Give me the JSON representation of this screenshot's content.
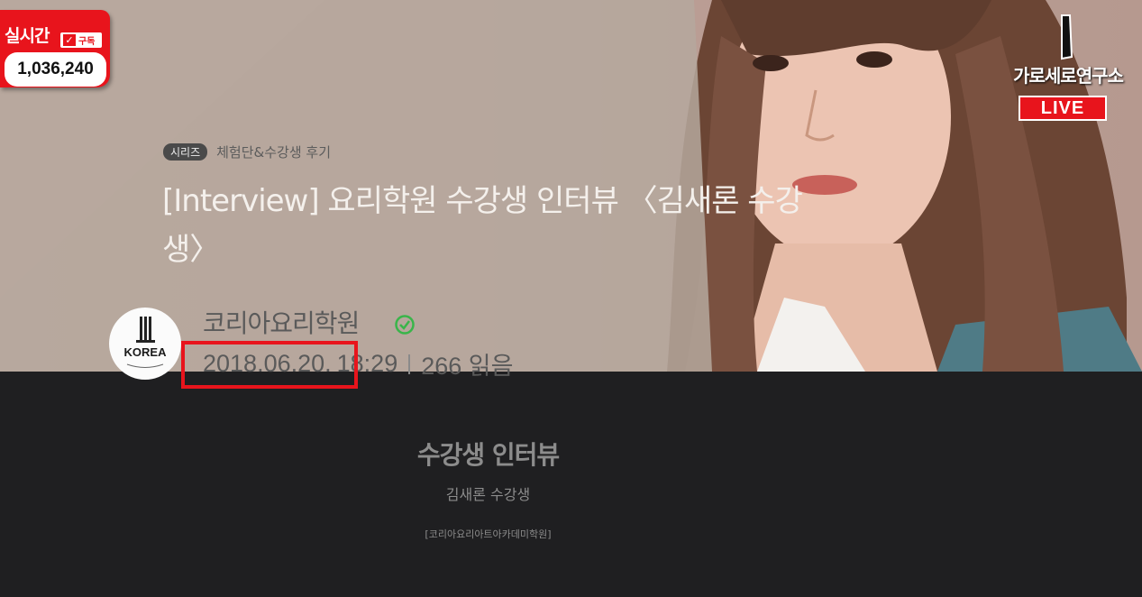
{
  "counter": {
    "title": "실시간",
    "subscribe_label": "구독",
    "count": "1,036,240"
  },
  "channel": {
    "name": "가로세로연구소",
    "live_label": "LIVE"
  },
  "article": {
    "series_badge": "시리즈",
    "series_name": "체험단&수강생 후기",
    "title": "[Interview] 요리학원 수강생 인터뷰 〈김새론 수강생〉",
    "author": "코리아요리학원",
    "avatar_text": "KOREA",
    "date": "2018.06.20.",
    "time": "18:29",
    "reads": "266 읽음"
  },
  "lower": {
    "heading": "수강생 인터뷰",
    "subheading": "김새론 수강생",
    "source": "[코리아요리아트아카데미학원]"
  },
  "colors": {
    "accent_red": "#e8141c",
    "verified_green": "#3ab54a"
  }
}
